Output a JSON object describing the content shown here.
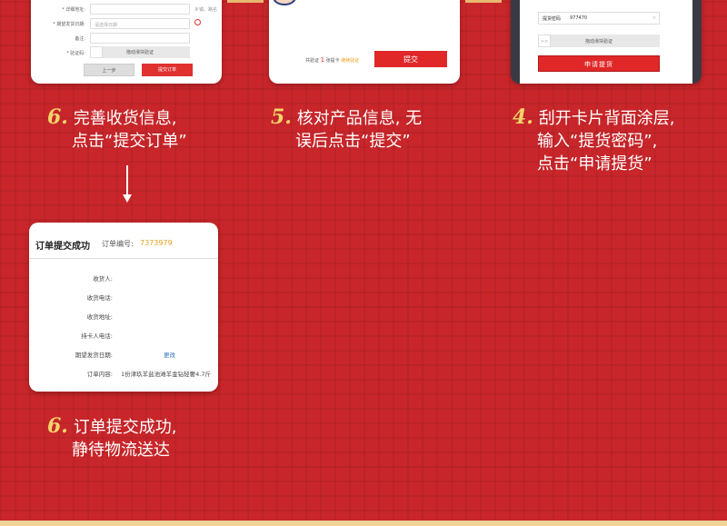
{
  "form_card": {
    "rows": [
      {
        "label": "* 详细地址:",
        "value": "",
        "hint": "乡镇、路名"
      },
      {
        "label": "* 期望发货日期:",
        "value": "请选择日期"
      },
      {
        "label": "备注:",
        "value": ""
      },
      {
        "label": "* 验证码:",
        "value": "拖动滑块验证"
      }
    ],
    "prev_button": "上一步",
    "submit_button": "提交订单"
  },
  "product_card": {
    "total_prefix": "共验证",
    "quantity": "1",
    "unit": "张提卡",
    "continue_link": "继续验证",
    "submit_button": "提交"
  },
  "card_redeem": {
    "password_label": "提货密码",
    "password_value": "977470",
    "clear_icon": "×",
    "slider_handle": ">>",
    "slider_text": "拖动滑块验证",
    "apply_button": "申请提货"
  },
  "steps": {
    "step6a": {
      "num": "6.",
      "line1": "完善收货信息,",
      "line2": "点击“提交订单”"
    },
    "step5": {
      "num": "5.",
      "line1": "核对产品信息, 无",
      "line2": "误后点击“提交”"
    },
    "step4": {
      "num": "4.",
      "line1": "刮开卡片背面涂层,",
      "line2": "输入“提货密码”,",
      "line3": "点击“申请提货”"
    },
    "step6b": {
      "num": "6.",
      "line1": "订单提交成功,",
      "line2": "静待物流送达"
    }
  },
  "success_card": {
    "title": "订单提交成功",
    "order_no_label": "订单编号:",
    "order_no": "7373979",
    "rows": [
      {
        "label": "收货人:",
        "value": ""
      },
      {
        "label": "收货电话:",
        "value": ""
      },
      {
        "label": "收货地址:",
        "value": ""
      },
      {
        "label": "持卡人电话:",
        "value": ""
      },
      {
        "label": "期望发货日期:",
        "value": "更改"
      },
      {
        "label": "订单内容:",
        "value": "1份津玖羊盐池滩羊金钻轻奢4.7斤"
      }
    ]
  },
  "colors": {
    "background": "#c8262a",
    "accent_red": "#e02828",
    "gold": "#f3d36a",
    "order_orange": "#e8a020",
    "link_blue": "#3070c0"
  }
}
